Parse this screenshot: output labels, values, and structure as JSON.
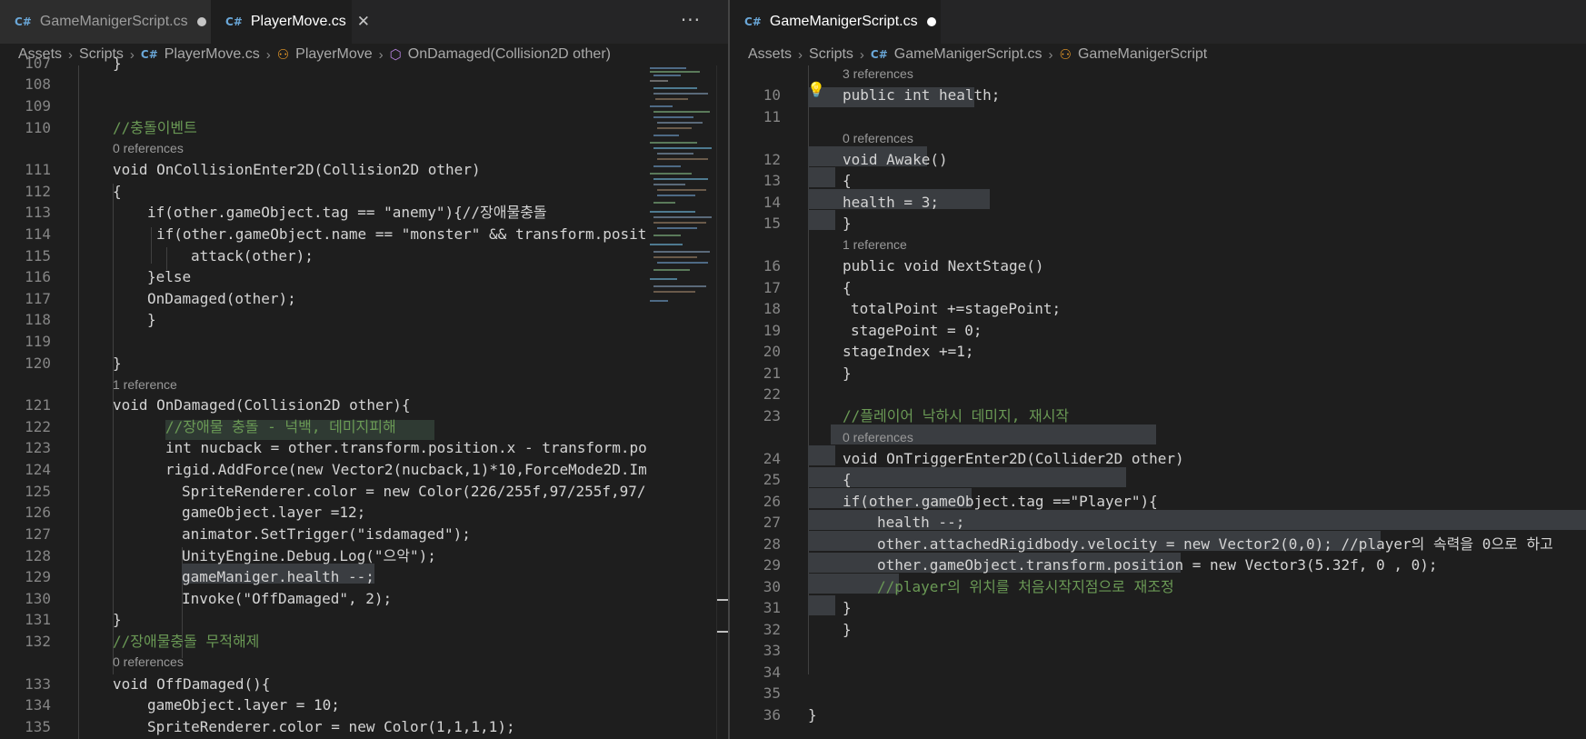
{
  "left": {
    "tabs": [
      {
        "label": "GameManigerScript.cs",
        "state": "modified",
        "active": false
      },
      {
        "label": "PlayerMove.cs",
        "state": "close",
        "active": true
      }
    ],
    "more_icon": "ellipsis-icon",
    "breadcrumb": [
      "Assets",
      "Scripts",
      "PlayerMove.cs",
      "PlayerMove",
      "OnDamaged(Collision2D other)"
    ],
    "partial_line_number": "107",
    "lines": [
      {
        "n": "108"
      },
      {
        "n": "109"
      },
      {
        "n": "110",
        "comment": "//충돌이벤트"
      },
      {
        "lens": "0 references"
      },
      {
        "n": "111",
        "text": "void OnCollisionEnter2D(Collision2D other)"
      },
      {
        "n": "112",
        "text": "{"
      },
      {
        "n": "113",
        "text": "if(other.gameObject.tag == \"anemy\"){//장애물충돌"
      },
      {
        "n": "114",
        "text": "if(other.gameObject.name == \"monster\" && transform.posit"
      },
      {
        "n": "115",
        "text": "attack(other);"
      },
      {
        "n": "116",
        "text": "}else"
      },
      {
        "n": "117",
        "text": "OnDamaged(other);"
      },
      {
        "n": "118",
        "text": "}"
      },
      {
        "n": "119"
      },
      {
        "n": "120",
        "text": "}"
      },
      {
        "lens": "1 reference"
      },
      {
        "n": "121",
        "text": "void OnDamaged(Collision2D other){"
      },
      {
        "n": "122",
        "text": "//장애물 충돌 - 넉백, 데미지피해"
      },
      {
        "n": "123",
        "text": "int nucback = other.transform.position.x - transform.po"
      },
      {
        "n": "124",
        "text": "rigid.AddForce(new Vector2(nucback,1)*10,ForceMode2D.Im"
      },
      {
        "n": "125",
        "text": "SpriteRenderer.color = new Color(226/255f,97/255f,97/"
      },
      {
        "n": "126",
        "text": "gameObject.layer =12;"
      },
      {
        "n": "127",
        "text": "animator.SetTrigger(\"isdamaged\");"
      },
      {
        "n": "128",
        "text": "UnityEngine.Debug.Log(\"으악\");"
      },
      {
        "n": "129",
        "text": "gameManiger.health --;"
      },
      {
        "n": "130",
        "text": "Invoke(\"OffDamaged\", 2);"
      },
      {
        "n": "131",
        "text": "}"
      },
      {
        "n": "132",
        "text": "//장애물충돌 무적해제"
      },
      {
        "lens": "0 references"
      },
      {
        "n": "133",
        "text": "void OffDamaged(){"
      },
      {
        "n": "134",
        "text": "gameObject.layer = 10;"
      },
      {
        "n": "135",
        "text": "SpriteRenderer.color = new Color(1,1,1,1);"
      }
    ]
  },
  "right": {
    "tabs": [
      {
        "label": "GameManigerScript.cs",
        "state": "modified",
        "active": true
      }
    ],
    "breadcrumb": [
      "Assets",
      "Scripts",
      "GameManigerScript.cs",
      "GameManigerScript"
    ],
    "lines": [
      {
        "lens": "3 references"
      },
      {
        "n": "10",
        "text": "public int health;"
      },
      {
        "n": "11"
      },
      {
        "lens": "0 references"
      },
      {
        "n": "12",
        "text": "void Awake()"
      },
      {
        "n": "13",
        "text": "{"
      },
      {
        "n": "14",
        "text": "health = 3;"
      },
      {
        "n": "15",
        "text": "}"
      },
      {
        "lens": "1 reference"
      },
      {
        "n": "16",
        "text": "public void NextStage()"
      },
      {
        "n": "17",
        "text": "{"
      },
      {
        "n": "18",
        "text": "totalPoint +=stagePoint;"
      },
      {
        "n": "19",
        "text": "stagePoint = 0;"
      },
      {
        "n": "20",
        "text": "stageIndex +=1;"
      },
      {
        "n": "21",
        "text": "}"
      },
      {
        "n": "22"
      },
      {
        "n": "23",
        "text": "//플레이어 낙하시 데미지, 재시작"
      },
      {
        "lens": "0 references"
      },
      {
        "n": "24",
        "text": "void OnTriggerEnter2D(Collider2D other)"
      },
      {
        "n": "25",
        "text": "{"
      },
      {
        "n": "26",
        "text": "if(other.gameObject.tag ==\"Player\"){"
      },
      {
        "n": "27",
        "text": "health --;"
      },
      {
        "n": "28",
        "text": "other.attachedRigidbody.velocity = new Vector2(0,0); //player의 속력을 0으로 하고"
      },
      {
        "n": "29",
        "text": "other.gameObject.transform.position = new Vector3(5.32f, 0 , 0);"
      },
      {
        "n": "30",
        "text": "//player의 위치를 처음시작지점으로 재조정"
      },
      {
        "n": "31",
        "text": "}"
      },
      {
        "n": "32",
        "text": "}"
      },
      {
        "n": "33"
      },
      {
        "n": "34"
      },
      {
        "n": "35"
      },
      {
        "n": "36",
        "text": "}"
      }
    ],
    "lightbulb_icon": "lightbulb-icon"
  },
  "colors": {
    "background": "#1e1e1e",
    "keyword": "#569cd6",
    "type": "#4ec9b0",
    "function": "#dcdcaa",
    "variable": "#9cdcfe",
    "string": "#ce9178",
    "comment": "#6a9955",
    "number": "#b5cea8",
    "control": "#c586c0"
  }
}
